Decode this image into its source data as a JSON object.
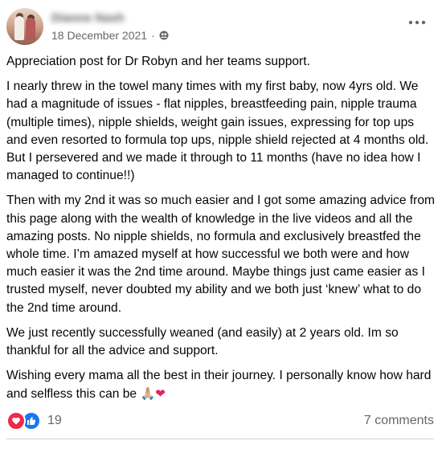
{
  "post": {
    "author": "Dianne Nash",
    "date": "18 December 2021",
    "separator": "·",
    "privacy_icon": "friends-icon",
    "paragraphs": [
      "Appreciation post for Dr Robyn and her teams support.",
      "I nearly threw in the towel many times with my first baby, now 4yrs old. We had a magnitude of issues - flat nipples, breastfeeding pain, nipple trauma (multiple times), nipple shields,  weight gain issues, expressing for top ups and even resorted to formula top ups, nipple shield rejected at 4 months old. But I persevered and we made it through to 11 months (have no idea how I managed to continue!!)",
      "Then with my 2nd it was so much easier and I got some amazing advice from this page along with the wealth of knowledge in the live videos and all the amazing posts. No nipple shields, no formula and exclusively breastfed the whole time. I’m amazed myself at how successful we both were and how much easier it was the 2nd time around. Maybe things just came easier as I trusted myself, never doubted my ability and we both just ‘knew’ what to do the 2nd time around.",
      "We just recently successfully weaned  (and easily) at 2 years old.  Im so thankful for all the advice and support."
    ],
    "closing_text": "Wishing every mama all the best in their journey. I personally know how hard and selfless this can be ",
    "closing_emoji_1": "🙏🏼",
    "closing_emoji_2": "❤",
    "reaction_count": "19",
    "comments_label": "7 comments",
    "colors": {
      "love": "#f02849",
      "like": "#1877f2",
      "muted": "#65676b"
    }
  }
}
